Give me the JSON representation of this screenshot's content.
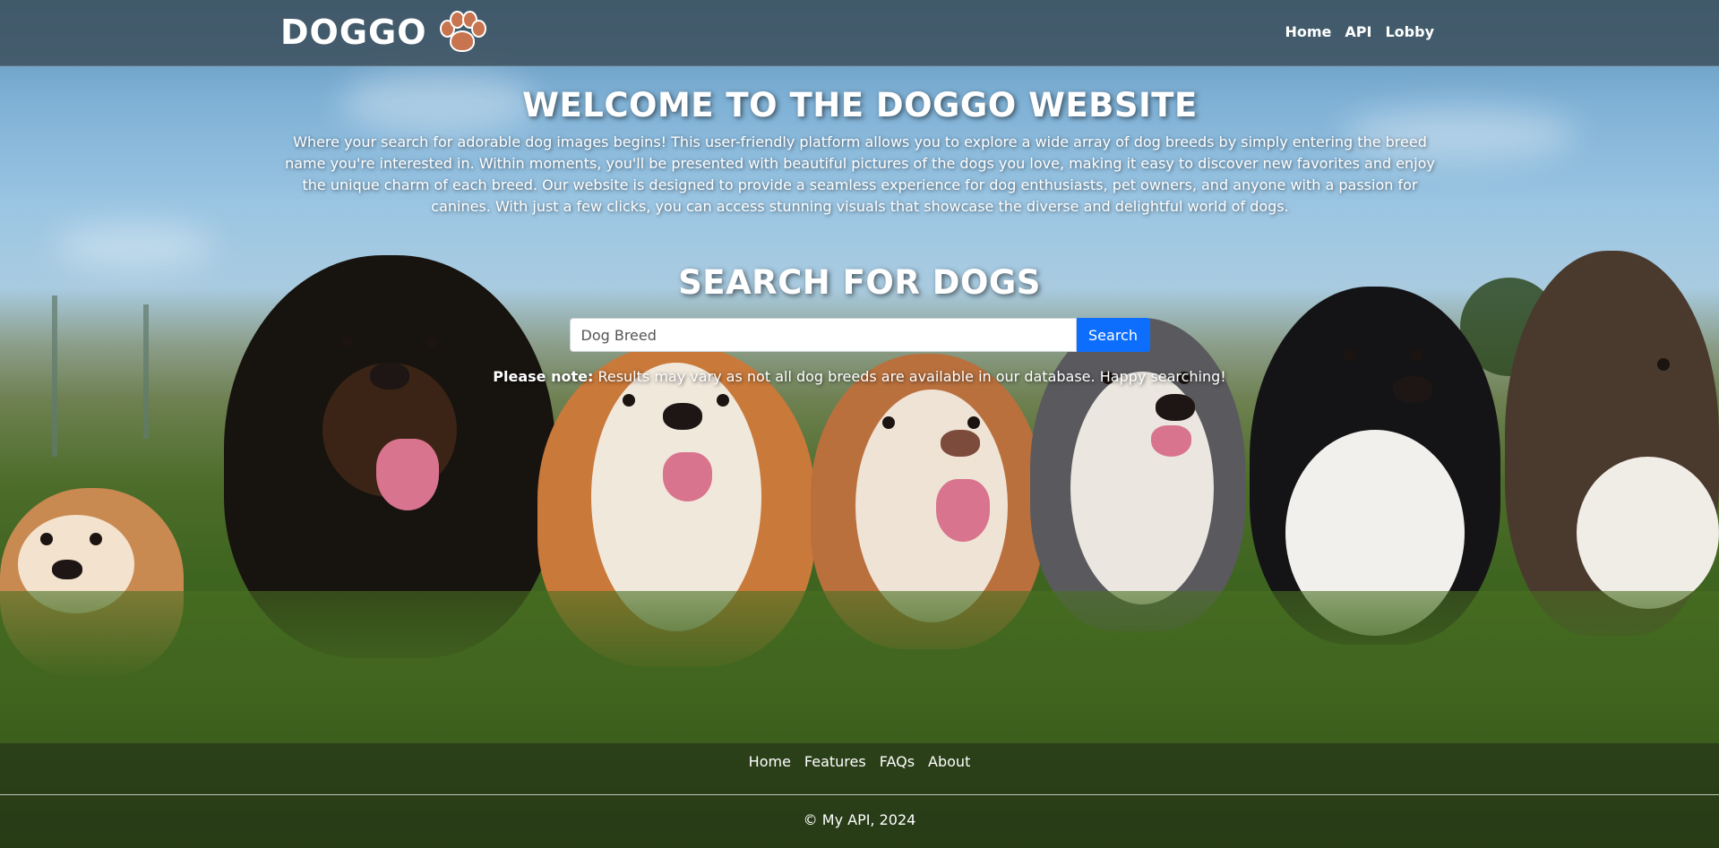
{
  "header": {
    "brand": "DOGGO",
    "brand_icon": "paw-icon",
    "nav": [
      "Home",
      "API",
      "Lobby"
    ]
  },
  "hero": {
    "title": "WELCOME TO THE DOGGO WEBSITE",
    "description": "Where your search for adorable dog images begins! This user-friendly platform allows you to explore a wide array of dog breeds by simply entering the breed name you're interested in. Within moments, you'll be presented with beautiful pictures of the dogs you love, making it easy to discover new favorites and enjoy the unique charm of each breed. Our website is designed to provide a seamless experience for dog enthusiasts, pet owners, and anyone with a passion for canines. With just a few clicks, you can access stunning visuals that showcase the diverse and delightful world of dogs."
  },
  "search": {
    "title": "SEARCH FOR DOGS",
    "placeholder": "Dog Breed",
    "value": "",
    "button_label": "Search",
    "note_label": "Please note:",
    "note_text": " Results may vary as not all dog breeds are available in our database. Happy searching!"
  },
  "footer": {
    "links": [
      "Home",
      "Features",
      "FAQs",
      "About"
    ],
    "copyright": "© My API, 2024"
  },
  "colors": {
    "navbar": "#3e5260",
    "button": "#0d6efd",
    "paw": "#c7744f"
  }
}
